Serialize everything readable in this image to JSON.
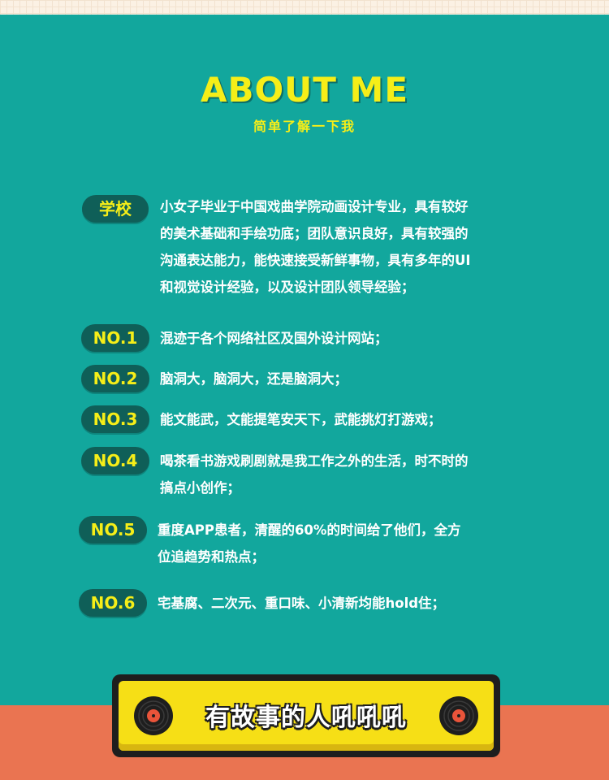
{
  "header": {
    "title": "ABOUT ME",
    "subtitle": "简单了解一下我"
  },
  "items": [
    {
      "badge": "学校",
      "lines": [
        "小女子毕业于中国戏曲学院动画设计专业，具有较好",
        "的美术基础和手绘功底；团队意识良好，具有较强的",
        "沟通表达能力，能快速接受新鲜事物，具有多年的UI",
        "和视觉设计经验，以及设计团队领导经验；"
      ]
    },
    {
      "badge": "NO.1",
      "lines": [
        "混迹于各个网络社区及国外设计网站；"
      ]
    },
    {
      "badge": "NO.2",
      "lines": [
        "脑洞大，脑洞大，还是脑洞大；"
      ]
    },
    {
      "badge": "NO.3",
      "lines": [
        "能文能武，文能提笔安天下，武能挑灯打游戏；"
      ]
    },
    {
      "badge": "NO.4",
      "lines": [
        "喝茶看书游戏刷剧就是我工作之外的生活，时不时的",
        "搞点小创作；"
      ]
    },
    {
      "badge": "NO.5",
      "lines": [
        "重度APP患者，清醒的60%的时间给了他们，全方",
        "位追趋势和热点；"
      ]
    },
    {
      "badge": "NO.6",
      "lines": [
        "宅基腐、二次元、重口味、小清新均能hold住；"
      ]
    }
  ],
  "banner": {
    "text": "有故事的人吼吼吼"
  },
  "colors": {
    "background": "#12a79d",
    "accent_yellow": "#f6ee18",
    "badge_bg": "#0f5f58",
    "bottom_band": "#ea7451"
  },
  "icons": [
    "vinyl-record-icon"
  ]
}
